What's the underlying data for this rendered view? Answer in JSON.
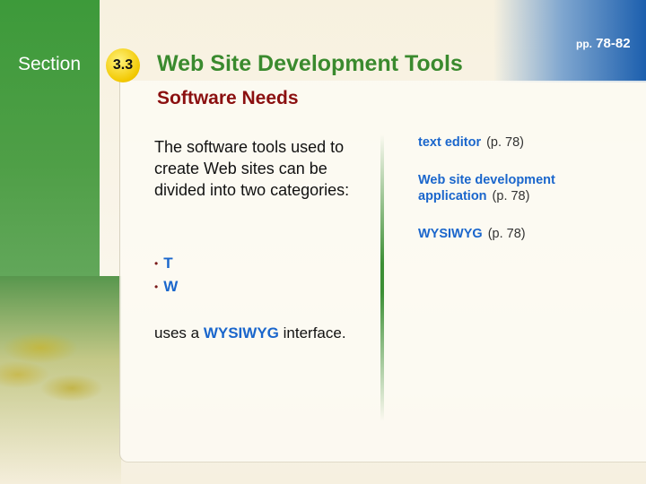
{
  "header": {
    "section_label": "Section",
    "section_number": "3.3",
    "title": "Web Site Development Tools",
    "pages_prefix": "pp.",
    "pages_range": "78-82"
  },
  "slide": {
    "subtitle": "Software Needs",
    "body": "The software tools used to create Web sites can be divided into two categories:",
    "bullets": [
      "T",
      "W"
    ],
    "wysiwyg_line": {
      "before": "uses a",
      "term": "WYSIWYG",
      "after": "interface."
    }
  },
  "terms": [
    {
      "name": "text editor",
      "ref": "(p. 78)"
    },
    {
      "name": "Web site development application",
      "ref": "(p. 78)"
    },
    {
      "name": "WYSIWYG",
      "ref": "(p. 78)"
    }
  ],
  "colors": {
    "title_green": "#3a8a2e",
    "subtitle_red": "#8b1010",
    "term_blue": "#1a66cc",
    "badge_yellow": "#f2c800"
  }
}
